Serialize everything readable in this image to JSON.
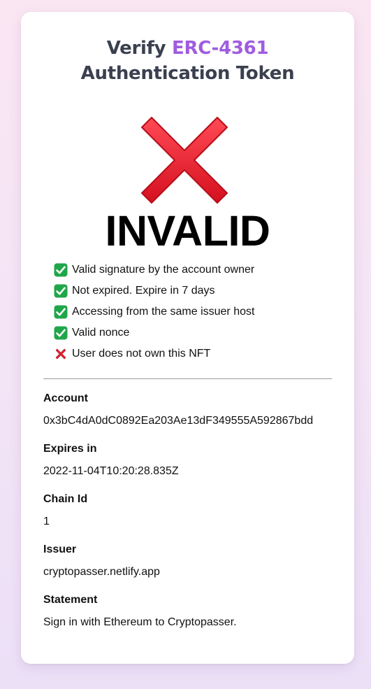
{
  "header": {
    "title_prefix": "Verify",
    "title_accent": "ERC-4361",
    "title_rest": "Authentication Token"
  },
  "result": {
    "icon": "red-cross-icon",
    "status": "INVALID"
  },
  "checks": [
    {
      "ok": true,
      "icon": "green-check-icon",
      "label": "Valid signature by the account owner"
    },
    {
      "ok": true,
      "icon": "green-check-icon",
      "label": "Not expired. Expire in 7 days"
    },
    {
      "ok": true,
      "icon": "green-check-icon",
      "label": "Accessing from the same issuer host"
    },
    {
      "ok": true,
      "icon": "green-check-icon",
      "label": "Valid nonce"
    },
    {
      "ok": false,
      "icon": "red-cross-icon",
      "label": "User does not own this NFT"
    }
  ],
  "details": [
    {
      "label": "Account",
      "value": "0x3bC4dA0dC0892Ea203Ae13dF349555A592867bdd"
    },
    {
      "label": "Expires in",
      "value": "2022-11-04T10:20:28.835Z"
    },
    {
      "label": "Chain Id",
      "value": "1"
    },
    {
      "label": "Issuer",
      "value": "cryptopasser.netlify.app"
    },
    {
      "label": "Statement",
      "value": "Sign in with Ethereum to Cryptopasser."
    }
  ],
  "colors": {
    "accent": "#a05ce0",
    "title": "#3b4050",
    "check_green": "#1fa64a",
    "cross_red": "#e0202f"
  }
}
